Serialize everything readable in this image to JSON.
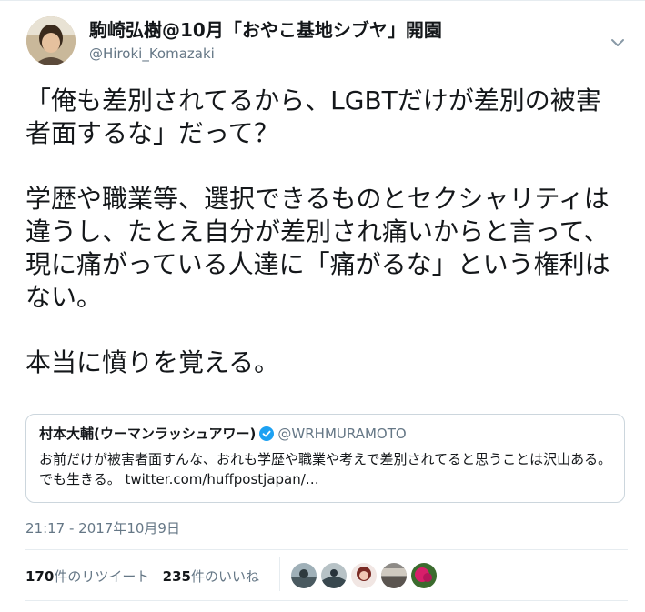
{
  "author": {
    "display_name": "駒崎弘樹@10月「おやこ基地シブヤ」開園",
    "handle": "@Hiroki_Komazaki"
  },
  "tweet": {
    "paragraphs": [
      "「俺も差別されてるから、LGBTだけが差別の被害者面するな」だって？",
      "学歴や職業等、選択できるものとセクシャリティは違うし、たとえ自分が差別され痛いからと言って、現に痛がっている人達に「痛がるな」という権利はない。",
      "本当に憤りを覚える。"
    ]
  },
  "quoted_tweet": {
    "display_name": "村本大輔(ウーマンラッシュアワー)",
    "handle": "@WRHMURAMOTO",
    "text": "お前だけが被害者面すんな、おれも学歴や職業や考えで差別されてると思うことは沢山ある。でも生きる。 twitter.com/huffpostjapan/…"
  },
  "timestamp": "21:17 - 2017年10月9日",
  "stats": {
    "retweet_count": "170",
    "retweet_label": "件のリツイート",
    "like_count": "235",
    "like_label": "件のいいね"
  },
  "icons": [
    "avatar",
    "chevron-down-icon",
    "verified-badge-icon",
    "liker-avatar"
  ],
  "colors": {
    "text": "#14171a",
    "secondary": "#657786",
    "border": "#e6ecf0",
    "verified": "#1da1f2"
  }
}
